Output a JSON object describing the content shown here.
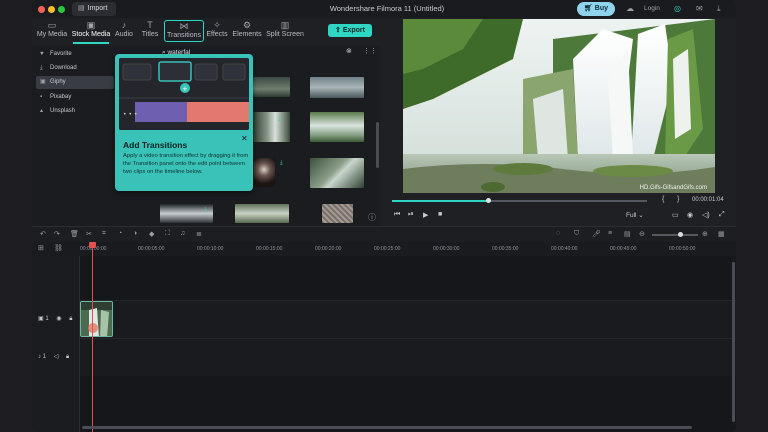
{
  "window": {
    "title": "Wondershare Filmora 11 (Untitled)"
  },
  "titlebar": {
    "import_label": "Import",
    "buy_label": "Buy",
    "login_label": "Login"
  },
  "tabs": [
    {
      "label": "My Media",
      "icon": "my-media-icon"
    },
    {
      "label": "Stock Media",
      "icon": "stock-media-icon"
    },
    {
      "label": "Audio",
      "icon": "audio-icon"
    },
    {
      "label": "Titles",
      "icon": "titles-icon"
    },
    {
      "label": "Transitions",
      "icon": "transitions-icon"
    },
    {
      "label": "Effects",
      "icon": "effects-icon"
    },
    {
      "label": "Elements",
      "icon": "elements-icon"
    },
    {
      "label": "Split Screen",
      "icon": "split-screen-icon"
    }
  ],
  "export_label": "Export",
  "library": {
    "items": [
      {
        "label": "Favorite",
        "icon": "heart-icon"
      },
      {
        "label": "Download",
        "icon": "download-icon"
      },
      {
        "label": "Giphy",
        "icon": "giphy-icon"
      },
      {
        "label": "Pixabay",
        "icon": "pixabay-icon"
      },
      {
        "label": "Unsplash",
        "icon": "unsplash-icon"
      }
    ],
    "selected_index": 2
  },
  "search": {
    "value": "waterfal"
  },
  "tooltip": {
    "title": "Add Transitions",
    "description": "Apply a video transition effect by dragging it from the Transition panel onto the edit point between two clips on the timeline below."
  },
  "preview": {
    "watermark": "HD.Gifs-GifsandGifs.com",
    "time": "00:00:01:04",
    "zoom_label": "Full",
    "progress_fraction": 0.38
  },
  "timeline": {
    "ruler_ticks": [
      "00:00:00:00",
      "00:00:05:00",
      "00:00:10:00",
      "00:00:15:00",
      "00:00:20:00",
      "00:00:25:00",
      "00:00:30:00",
      "00:00:35:00",
      "00:00:40:00",
      "00:00:45:00",
      "00:00:50:00"
    ],
    "video_track_label": "1",
    "audio_track_label": "1"
  },
  "colors": {
    "accent": "#2fd6c3",
    "buy": "#8fd3ec",
    "tooltip_bg": "#38c2b8",
    "playhead": "#e05252"
  }
}
